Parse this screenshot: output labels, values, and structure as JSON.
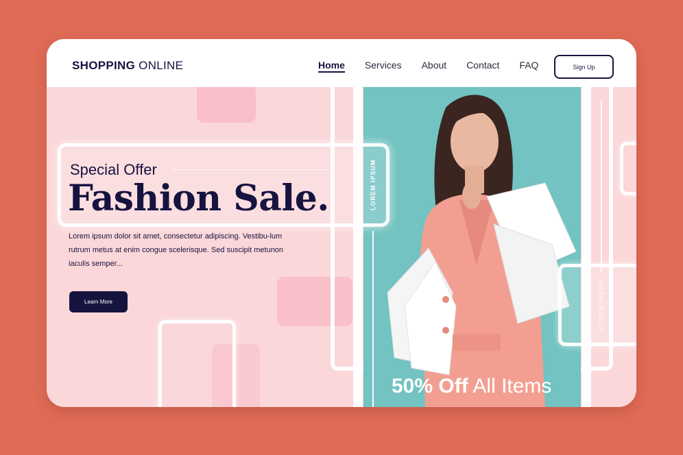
{
  "header": {
    "logo_bold": "SHOPPING",
    "logo_light": "ONLINE",
    "nav": [
      {
        "label": "Home"
      },
      {
        "label": "Services"
      },
      {
        "label": "About"
      },
      {
        "label": "Contact"
      },
      {
        "label": "FAQ"
      }
    ],
    "signup_label": "Sign Up"
  },
  "hero": {
    "kicker": "Special Offer",
    "title": "Fashion Sale.",
    "body": "Lorem ipsum dolor sit amet, consectetur adipiscing. Vestibu-lum rutrum metus at enim congue scelerisque. Sed suscipit metunon iaculis semper...",
    "cta_label": "Learn More"
  },
  "labels": {
    "vertical_1": "LOREM IPSUM",
    "vertical_2": "LOREM IPSUM"
  },
  "promo": {
    "bold": "50% Off",
    "light": "All Items"
  },
  "colors": {
    "background": "#e06c57",
    "card": "#fbd7d9",
    "navy": "#16133f",
    "teal": "#72c3c1",
    "coat": "#f29f92"
  }
}
